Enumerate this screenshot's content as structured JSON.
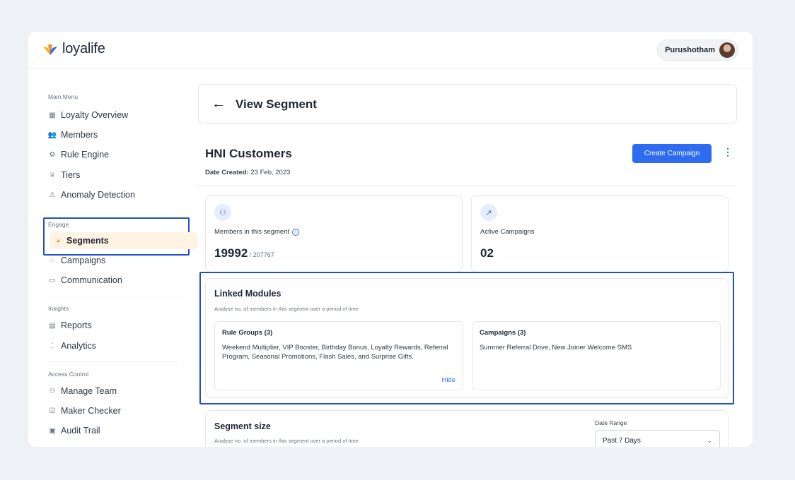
{
  "app": {
    "logo_text": "loyalife",
    "brand_colors": {
      "primary": "#2d6cf0",
      "accent": "#ff8a1f",
      "highlight": "#2150c9"
    },
    "user": {
      "name": "Purushotham",
      "icon": "user-avatar"
    }
  },
  "sidebar": {
    "sections": [
      {
        "label": "Main Menu",
        "items": [
          {
            "label": "Loyalty Overview",
            "icon": "grid-icon"
          },
          {
            "label": "Members",
            "icon": "members-icon"
          },
          {
            "label": "Rule Engine",
            "icon": "rule-engine-icon"
          },
          {
            "label": "Tiers",
            "icon": "tiers-icon"
          },
          {
            "label": "Anomaly Detection",
            "icon": "anomaly-icon"
          }
        ]
      },
      {
        "label": "Engage",
        "items": [
          {
            "label": "Segments",
            "icon": "pie-chart-icon",
            "active": true
          },
          {
            "label": "Campaigns",
            "icon": "campaign-icon"
          },
          {
            "label": "Communication",
            "icon": "chat-icon"
          }
        ]
      },
      {
        "label": "Insights",
        "items": [
          {
            "label": "Reports",
            "icon": "report-icon"
          },
          {
            "label": "Analytics",
            "icon": "analytics-icon"
          }
        ]
      },
      {
        "label": "Access Control",
        "items": [
          {
            "label": "Manage Team",
            "icon": "team-icon"
          },
          {
            "label": "Maker Checker",
            "icon": "maker-checker-icon"
          },
          {
            "label": "Audit Trail",
            "icon": "audit-icon"
          }
        ]
      }
    ]
  },
  "main": {
    "page_title": "View Segment",
    "segment": {
      "name": "HNI Customers",
      "date_label": "Date Created:",
      "date_value": "23 Feb, 2023",
      "create_button": "Create Campaign"
    },
    "stats": [
      {
        "label": "Members in this segment",
        "value": "19992",
        "sub": " / 207767",
        "icon": "members-group-icon"
      },
      {
        "label": "Active Campaigns",
        "value": "02",
        "sub": "",
        "icon": "trend-up-icon"
      }
    ],
    "linked_modules": {
      "title": "Linked Modules",
      "subtitle": "Analyse no. of members in this segment over a period of time",
      "rule_groups": {
        "title": "Rule Groups (3)",
        "text": "Weekend Multiplier, VIP Booster, Birthday Bonus, Loyalty Rewards, Referral Program, Seasonal Promotions, Flash Sales, and Surprise Gifts.",
        "hide_label": "Hide"
      },
      "campaigns": {
        "title": "Campaigns (3)",
        "text": "Summer Referral Drive, New Joiner Welcome SMS"
      }
    },
    "segment_size": {
      "title": "Segment size",
      "subtitle": "Analyse no. of members in this segment over a period of time",
      "date_range_label": "Date Range",
      "date_range_value": "Past 7 Days"
    }
  }
}
